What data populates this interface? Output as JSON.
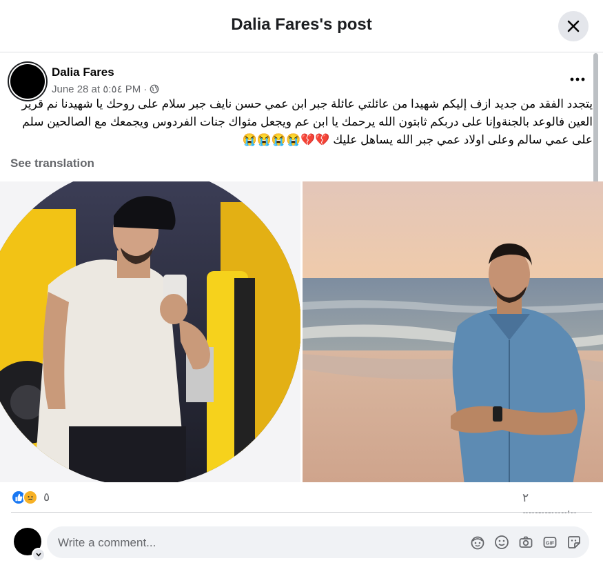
{
  "dialog": {
    "title": "Dalia Fares's post"
  },
  "post": {
    "author": "Dalia Fares",
    "date": "June 28 at ٥:٥٤ PM",
    "separator": "·",
    "privacy_icon": "globe-icon",
    "text": "يتجدد الفقد من جديد ازف إليكم شهيدا من عائلتي عائلة جبر ابن عمي حسن نايف جبر سلام على روحك يا شهيدنا نم قرير العين فالوعد بالجنةوإنا على دربكم ثابتون الله يرحمك يا ابن عم ويجعل مثواك جنات الفردوس ويجمعك مع الصالحين سلم على عمي سالم وعلى اولاد عمي جبر الله يساهل عليك 💔💔😭😭😭😭",
    "see_translation": "See translation"
  },
  "reactions": {
    "icons": [
      "like-icon",
      "sad-icon"
    ],
    "count": "٥",
    "comments": "٢ comments"
  },
  "comment_box": {
    "placeholder": "Write a comment...",
    "tools": [
      "avatar-sticker-icon",
      "emoji-icon",
      "camera-icon",
      "gif-icon",
      "sticker-icon"
    ]
  },
  "colors": {
    "like_blue": "#1877f2",
    "sad_yellow": "#f7b125",
    "close_bg": "#e4e6eb",
    "secondary_text": "#65676b"
  }
}
